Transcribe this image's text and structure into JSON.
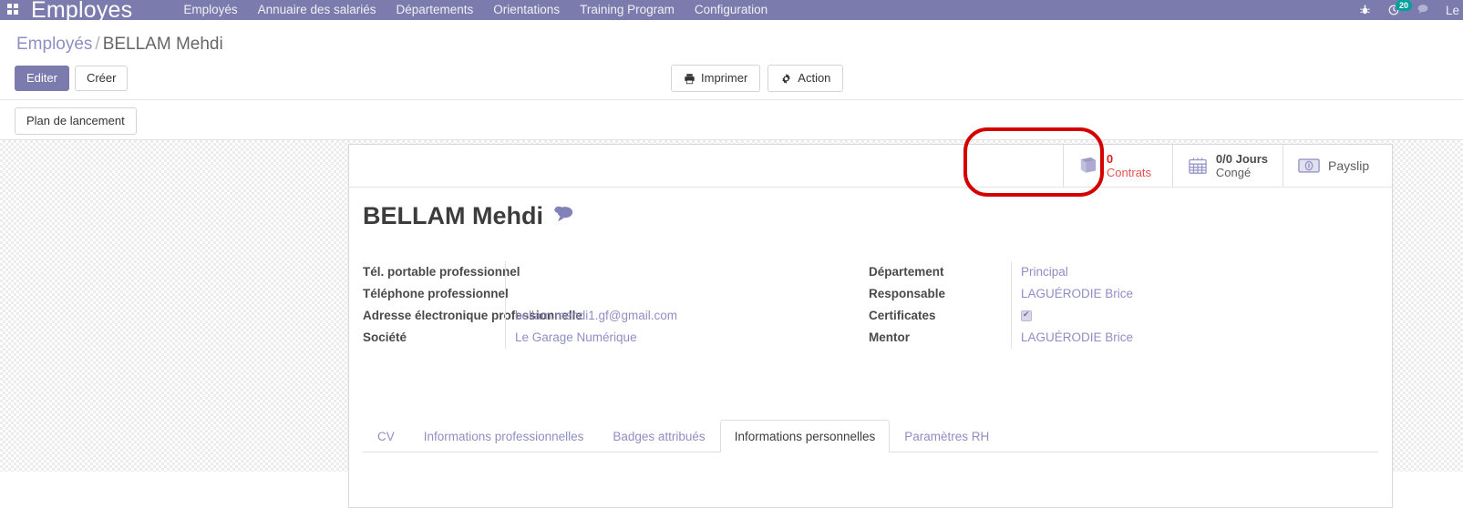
{
  "navbar": {
    "apps_icon": "apps-grid-icon",
    "brand": "Employes",
    "menu": [
      {
        "label": "Employés"
      },
      {
        "label": "Annuaire des salariés"
      },
      {
        "label": "Départements"
      },
      {
        "label": "Orientations"
      },
      {
        "label": "Training Program"
      },
      {
        "label": "Configuration"
      }
    ],
    "right": {
      "bug_icon": "bug-icon",
      "activity_icon": "clock-icon",
      "activity_count": "20",
      "messages_icon": "chat-bubble-icon",
      "user_name": "Le"
    }
  },
  "control_panel": {
    "breadcrumb": {
      "root": "Employés",
      "separator": "/",
      "current": "BELLAM Mehdi"
    },
    "edit_label": "Editer",
    "create_label": "Créer",
    "print_label": "Imprimer",
    "action_label": "Action",
    "launch_plan_label": "Plan de lancement"
  },
  "stat_buttons": [
    {
      "icon": "book-icon",
      "value": "0",
      "label": "Contrats",
      "style": "danger"
    },
    {
      "icon": "calendar-icon",
      "value": "0/0 Jours",
      "label": "Congé",
      "style": "normal"
    },
    {
      "icon": "money-icon",
      "value": "",
      "label": "Payslip",
      "style": "flat"
    }
  ],
  "record": {
    "title": "BELLAM Mehdi",
    "chatter_icon": "chat-bubble-icon"
  },
  "fields_left": [
    {
      "label": "Tél. portable professionnel",
      "value": ""
    },
    {
      "label": "Téléphone professionnel",
      "value": ""
    },
    {
      "label": "Adresse électronique professionnelle",
      "value": "bellam.mehdi1.gf@gmail.com"
    },
    {
      "label": "Société",
      "value": "Le Garage Numérique"
    }
  ],
  "fields_right": [
    {
      "label": "Département",
      "value": "Principal",
      "type": "text"
    },
    {
      "label": "Responsable",
      "value": "LAGUÉRODIE Brice",
      "type": "text"
    },
    {
      "label": "Certificates",
      "value": "",
      "type": "checkbox"
    },
    {
      "label": "Mentor",
      "value": "LAGUÉRODIE Brice",
      "type": "text"
    }
  ],
  "notebook_tabs": [
    {
      "label": "CV",
      "active": false
    },
    {
      "label": "Informations professionnelles",
      "active": false
    },
    {
      "label": "Badges attribués",
      "active": false
    },
    {
      "label": "Informations personnelles",
      "active": true
    },
    {
      "label": "Paramètres RH",
      "active": false
    }
  ],
  "colors": {
    "brand_purple": "#7c7bad",
    "link_purple": "#8f8ec4",
    "annotation_red": "#d40000",
    "badge_teal": "#00a09d"
  }
}
